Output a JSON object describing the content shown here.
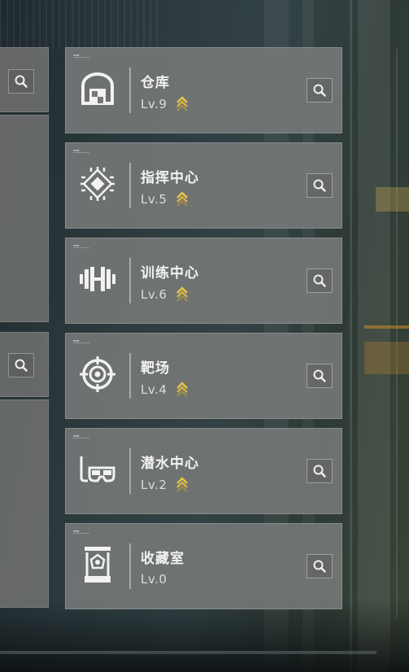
{
  "facilities": [
    {
      "name": "仓库",
      "level": "Lv.9",
      "icon": "warehouse-icon",
      "upgradable": true
    },
    {
      "name": "指挥中心",
      "level": "Lv.5",
      "icon": "command-chip-icon",
      "upgradable": true
    },
    {
      "name": "训练中心",
      "level": "Lv.6",
      "icon": "dumbbell-icon",
      "upgradable": true
    },
    {
      "name": "靶场",
      "level": "Lv.4",
      "icon": "target-icon",
      "upgradable": true
    },
    {
      "name": "潜水中心",
      "level": "Lv.2",
      "icon": "diving-mask-icon",
      "upgradable": true
    },
    {
      "name": "收藏室",
      "level": "Lv.0",
      "icon": "display-case-icon",
      "upgradable": false
    }
  ],
  "colors": {
    "card_bg": "#767878",
    "upgrade_gold": "#e8c24a",
    "upgrade_dim": "#9a8a50"
  }
}
